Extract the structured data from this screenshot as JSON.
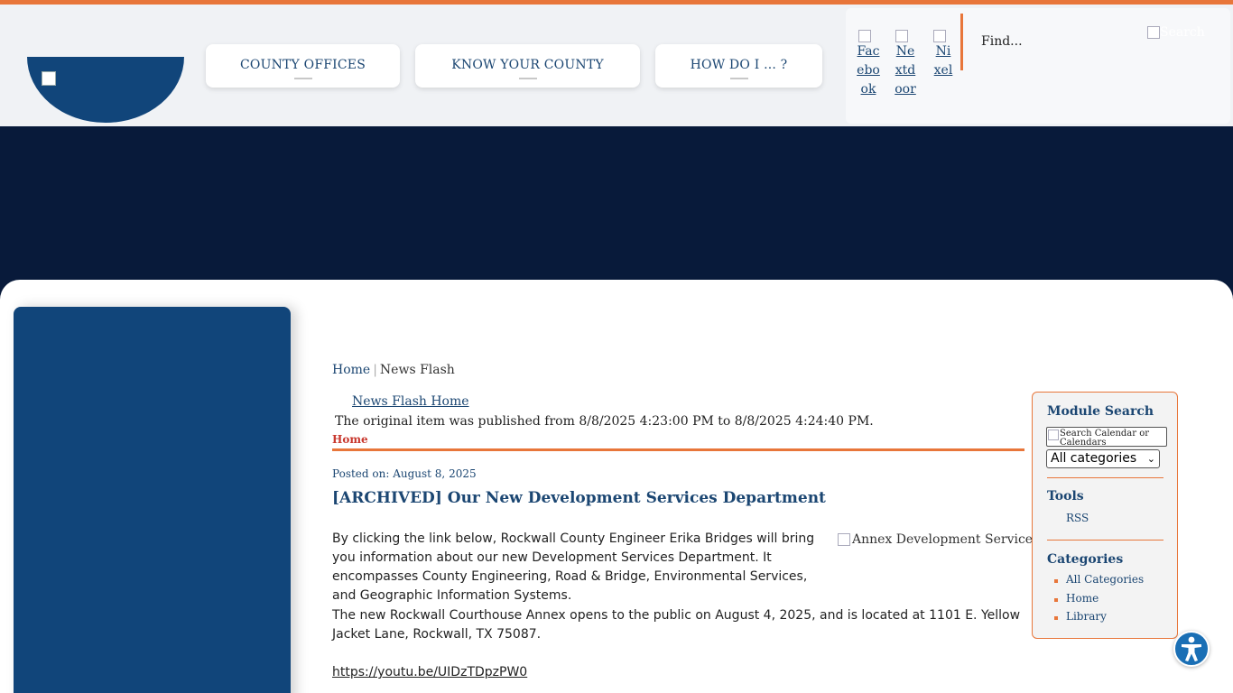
{
  "header": {
    "logo_alt": "",
    "nav": [
      {
        "label": "COUNTY OFFICES"
      },
      {
        "label": "KNOW YOUR COUNTY"
      },
      {
        "label": "HOW DO I ... ?"
      }
    ],
    "social": [
      {
        "label": "Facebook",
        "lines": [
          "Fac",
          "ebo",
          "ok"
        ]
      },
      {
        "label": "Nextdoor",
        "lines": [
          "Ne",
          "xtd",
          "oor"
        ]
      },
      {
        "label": "Nixel",
        "lines": [
          "Ni",
          "xel"
        ]
      }
    ],
    "search": {
      "placeholder": "Find...",
      "button_label": "Search"
    }
  },
  "breadcrumb": {
    "home": "Home",
    "separator": "|",
    "current": "News Flash"
  },
  "news": {
    "home_link": "News Flash Home",
    "original_note": "The original item was published from 8/8/2025 4:23:00 PM to 8/8/2025 4:24:40 PM.",
    "category": "Home",
    "posted": "Posted on: August 8, 2025",
    "title": "[ARCHIVED] Our New Development Services Department",
    "image_alt": "Annex Development Services",
    "paragraph1": "By clicking the link below, Rockwall County Engineer Erika Bridges will bring you information about our new Development Services Department. It encompasses County Engineering, Road & Bridge, Environmental Services, and Geographic Information Systems.",
    "paragraph2": "The new Rockwall Courthouse Annex opens to the public on August 4, 2025, and is located at 1101 E. Yellow Jacket Lane, Rockwall, TX 75087.",
    "link": "https://youtu.be/UIDzTDpzPW0"
  },
  "module": {
    "search_heading": "Module Search",
    "search_placeholder": "Search Calendar or Calendars",
    "select_value": "All categories",
    "tools_heading": "Tools",
    "rss": "RSS",
    "categories_heading": "Categories",
    "categories": [
      "All Categories",
      "Home",
      "Library"
    ]
  },
  "colors": {
    "accent_orange": "#e8763a",
    "navy": "#11457a",
    "hero_dark": "#081a3a",
    "link_blue": "#1b4672"
  },
  "icons": {
    "accessibility": "accessibility-icon"
  }
}
